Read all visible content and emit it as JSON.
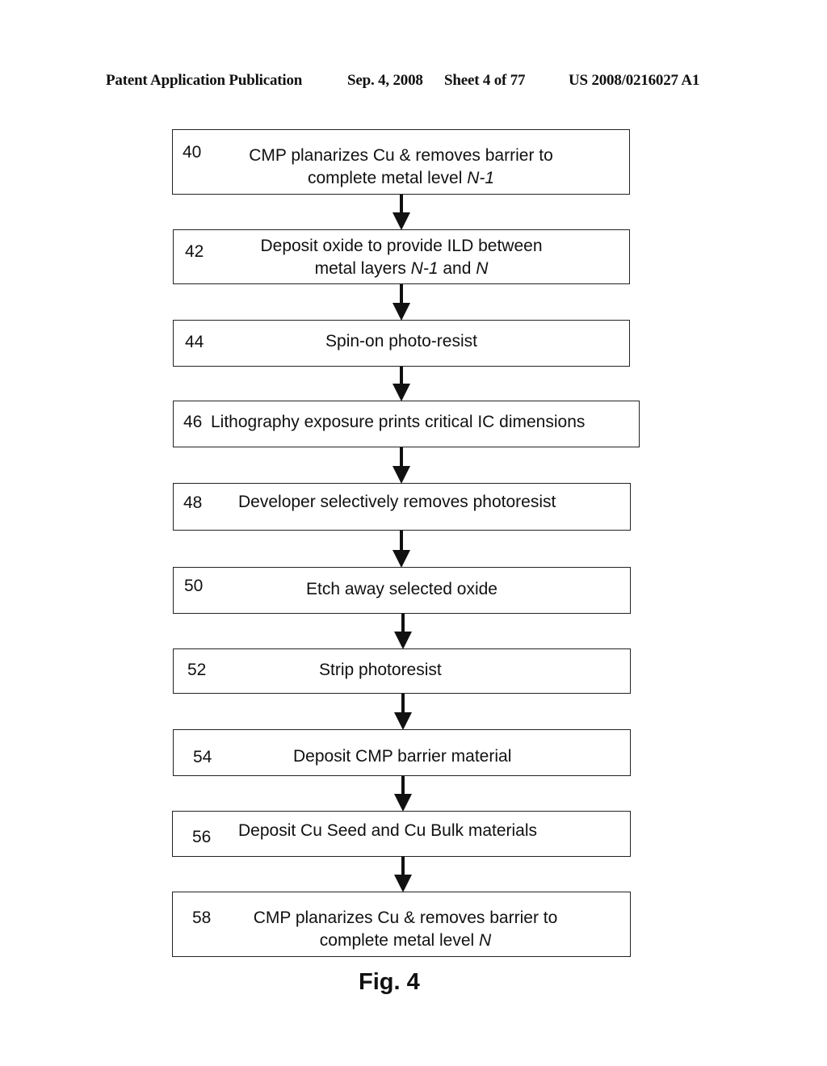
{
  "header": {
    "publication": "Patent Application Publication",
    "date": "Sep. 4, 2008",
    "sheet": "Sheet 4 of 77",
    "number": "US 2008/0216027 A1"
  },
  "steps": [
    {
      "num": "40",
      "line1": "CMP planarizes Cu & removes barrier to",
      "line2_pre": "complete metal level ",
      "line2_it": "N-1",
      "line2_mid": "",
      "line2_it2": ""
    },
    {
      "num": "42",
      "line1": "Deposit oxide to provide ILD between",
      "line2_pre": "metal layers ",
      "line2_it": "N-1",
      "line2_mid": " and ",
      "line2_it2": "N"
    },
    {
      "num": "44",
      "line1": "Spin-on photo-resist"
    },
    {
      "num": "46",
      "line1": "Lithography exposure prints critical IC dimensions"
    },
    {
      "num": "48",
      "line1": "Developer selectively removes photoresist"
    },
    {
      "num": "50",
      "line1": "Etch away selected oxide"
    },
    {
      "num": "52",
      "line1": "Strip photoresist"
    },
    {
      "num": "54",
      "line1": "Deposit CMP barrier material"
    },
    {
      "num": "56",
      "line1": "Deposit Cu Seed and Cu Bulk materials"
    },
    {
      "num": "58",
      "line1": "CMP planarizes Cu & removes barrier to",
      "line2_pre": "complete metal level ",
      "line2_it": "N",
      "line2_mid": "",
      "line2_it2": ""
    }
  ],
  "figure_label": "Fig. 4"
}
